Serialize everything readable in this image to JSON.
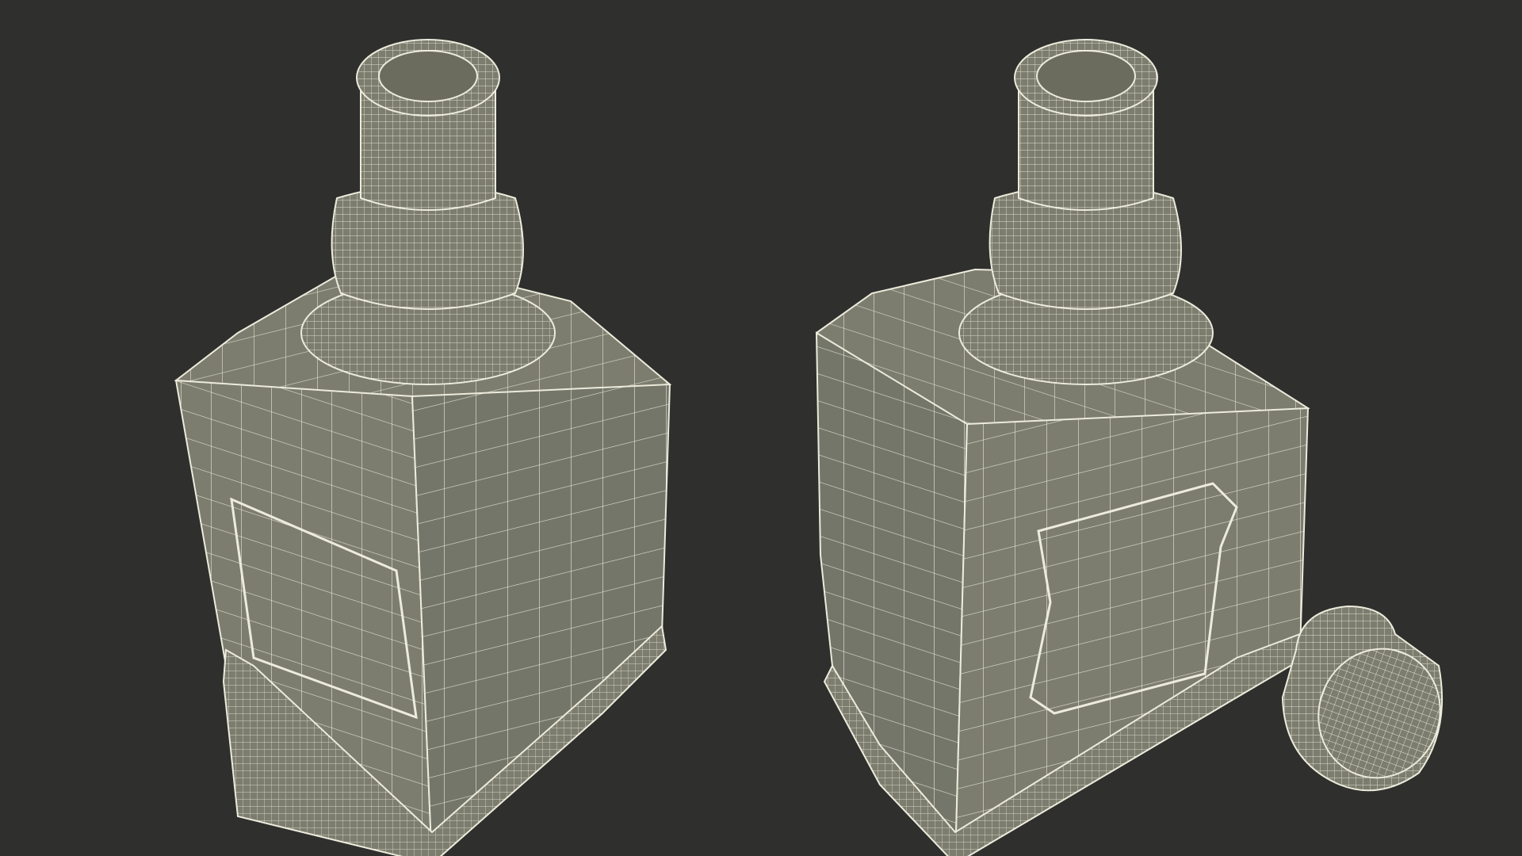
{
  "scene": {
    "background": "#2f2f2d",
    "surface_color": "#7c7d6e",
    "surface_dark": "#6b6c5e",
    "wire_color": "#ecebdc",
    "objects": [
      {
        "name": "bottle-left",
        "view": "front-left"
      },
      {
        "name": "bottle-right",
        "view": "back-right"
      },
      {
        "name": "bottle-cap",
        "view": "tilted"
      }
    ]
  }
}
